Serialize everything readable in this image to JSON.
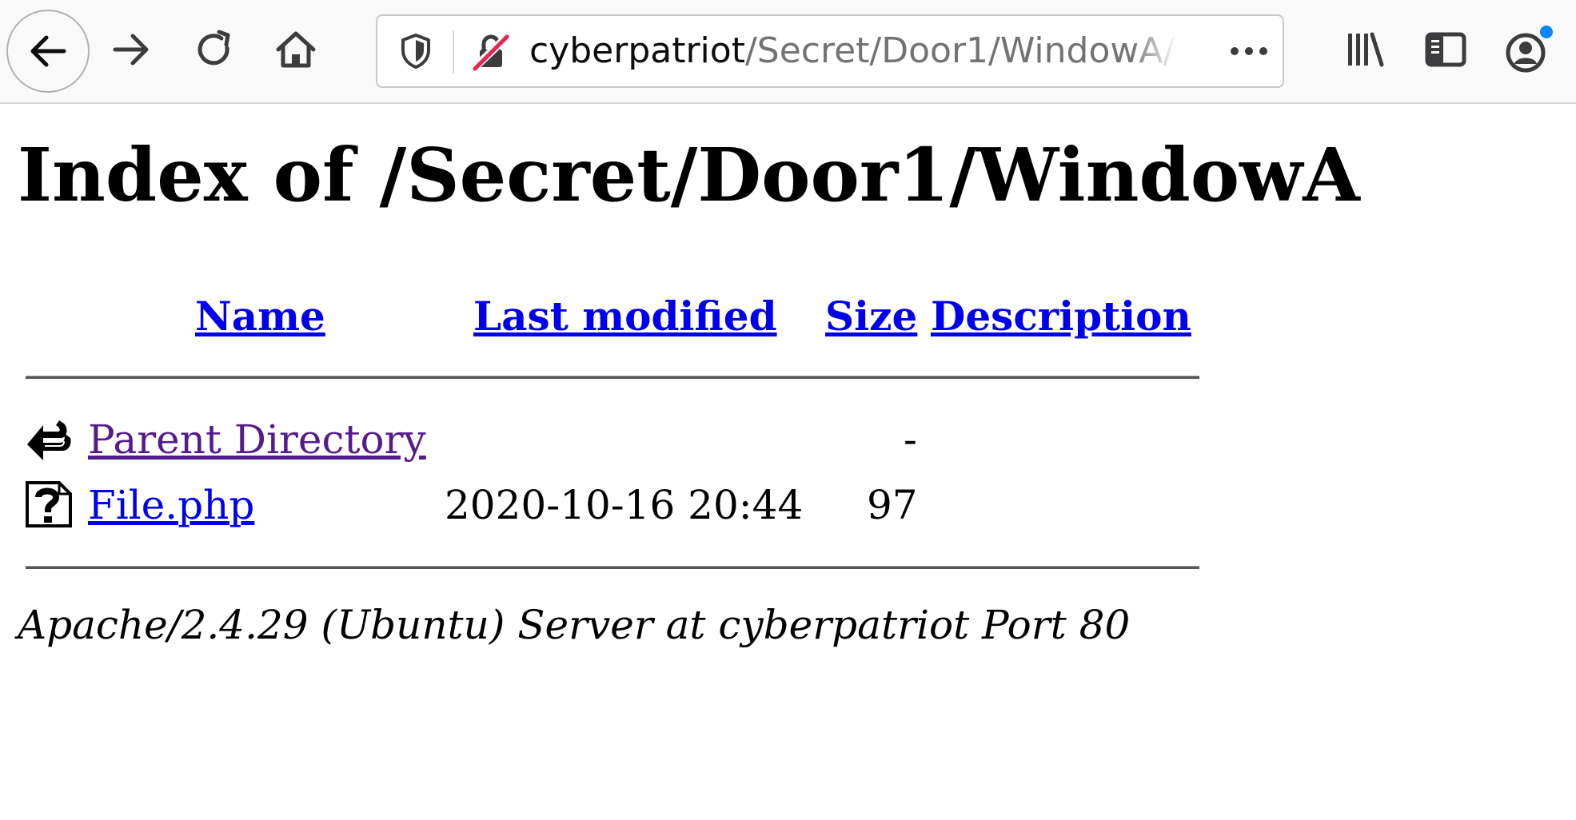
{
  "browser": {
    "url": {
      "host": "cyberpatriot",
      "path": "/Secret/Door1/WindowA/"
    },
    "page_actions_label": "•••",
    "icons": {
      "back": "back-arrow-icon",
      "forward": "forward-arrow-icon",
      "reload": "reload-icon",
      "home": "home-icon",
      "shield": "tracking-protection-shield-icon",
      "insecure": "insecure-connection-lock-icon",
      "library": "library-icon",
      "sidebar": "sidebar-icon",
      "account": "account-icon"
    },
    "colors": {
      "insecure_strike": "#e22850",
      "account_dot": "#0a84ff"
    }
  },
  "page": {
    "title": "Index of /Secret/Door1/WindowA",
    "columns": {
      "name": "Name",
      "last_modified": "Last modified",
      "size": "Size",
      "description": "Description"
    },
    "rows": [
      {
        "icon": "parent-directory-back-arrow-icon",
        "name": "Parent Directory",
        "last_modified": "",
        "size": "-",
        "description": "",
        "visited": true
      },
      {
        "icon": "unknown-file-icon",
        "name": "File.php",
        "last_modified": "2020-10-16 20:44",
        "size": "97",
        "description": "",
        "visited": false
      }
    ],
    "address": "Apache/2.4.29 (Ubuntu) Server at cyberpatriot Port 80"
  }
}
